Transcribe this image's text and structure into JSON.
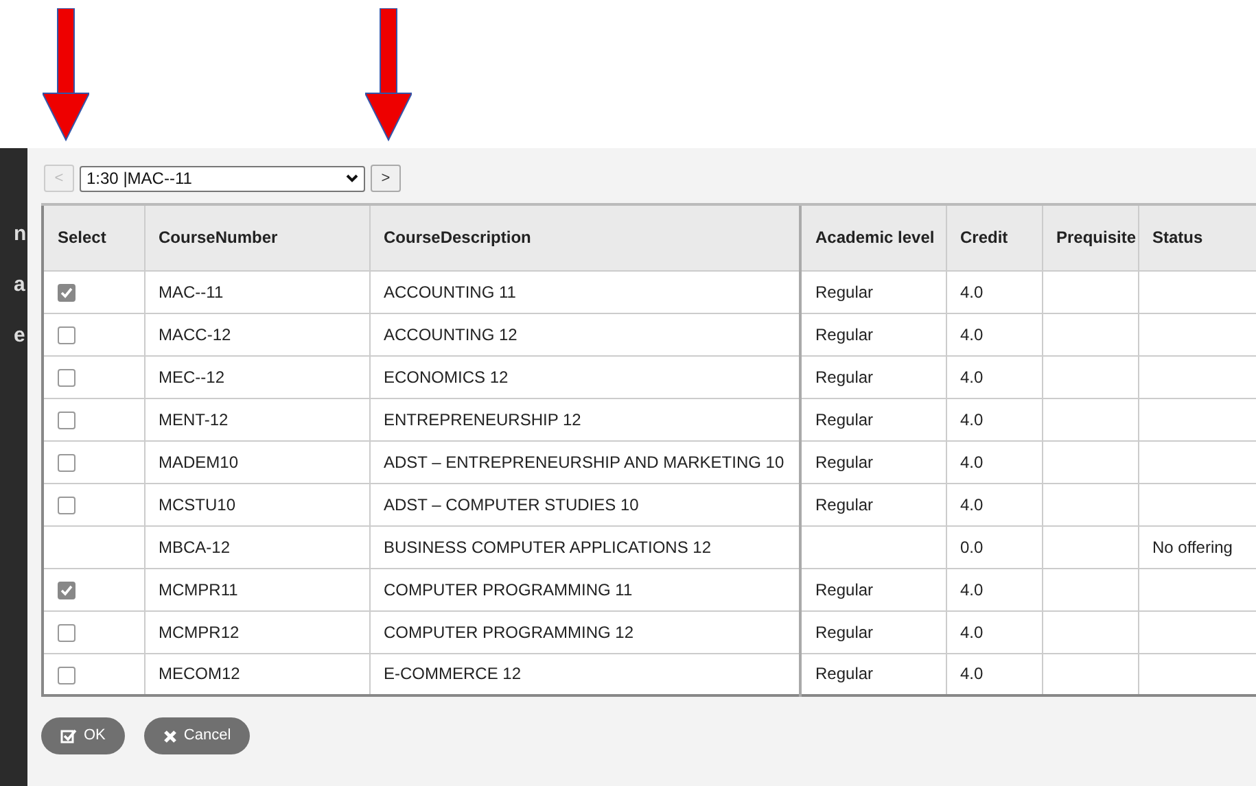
{
  "background_fragments": [
    "n",
    "a",
    "e"
  ],
  "navigator": {
    "prev": "<",
    "selection": "1:30 |MAC--11",
    "next": ">"
  },
  "table": {
    "columns": [
      "Select",
      "CourseNumber",
      "CourseDescription",
      "Academic level",
      "Credit",
      "Prequisite",
      "Status"
    ],
    "rows": [
      {
        "kind": "checkbox",
        "checked": true,
        "number": "MAC--11",
        "description": "ACCOUNTING 11",
        "level": "Regular",
        "credit": "4.0",
        "status": ""
      },
      {
        "kind": "checkbox",
        "checked": false,
        "number": "MACC-12",
        "description": "ACCOUNTING 12",
        "level": "Regular",
        "credit": "4.0",
        "status": ""
      },
      {
        "kind": "checkbox",
        "checked": false,
        "number": "MEC--12",
        "description": "ECONOMICS 12",
        "level": "Regular",
        "credit": "4.0",
        "status": ""
      },
      {
        "kind": "checkbox",
        "checked": false,
        "number": "MENT-12",
        "description": "ENTREPRENEURSHIP 12",
        "level": "Regular",
        "credit": "4.0",
        "status": ""
      },
      {
        "kind": "checkbox",
        "checked": false,
        "number": "MADEM10",
        "description": "ADST – ENTREPRENEURSHIP AND MARKETING 10",
        "level": "Regular",
        "credit": "4.0",
        "status": ""
      },
      {
        "kind": "checkbox",
        "checked": false,
        "number": "MCSTU10",
        "description": "ADST – COMPUTER STUDIES 10",
        "level": "Regular",
        "credit": "4.0",
        "status": ""
      },
      {
        "kind": "none",
        "number": "MBCA-12",
        "description": "BUSINESS COMPUTER APPLICATIONS 12",
        "level": "",
        "credit": "0.0",
        "status": "No offering"
      },
      {
        "kind": "checkbox",
        "checked": true,
        "number": "MCMPR11",
        "description": "COMPUTER PROGRAMMING 11",
        "level": "Regular",
        "credit": "4.0",
        "status": ""
      },
      {
        "kind": "checkbox",
        "checked": false,
        "number": "MCMPR12",
        "description": "COMPUTER PROGRAMMING 12",
        "level": "Regular",
        "credit": "4.0",
        "status": ""
      },
      {
        "kind": "checkbox",
        "checked": false,
        "number": "MECOM12",
        "description": "E-COMMERCE 12",
        "level": "Regular",
        "credit": "4.0",
        "status": ""
      }
    ]
  },
  "buttons": [
    {
      "kind": "ok",
      "label": "OK"
    },
    {
      "kind": "cancel",
      "label": "Cancel"
    }
  ]
}
